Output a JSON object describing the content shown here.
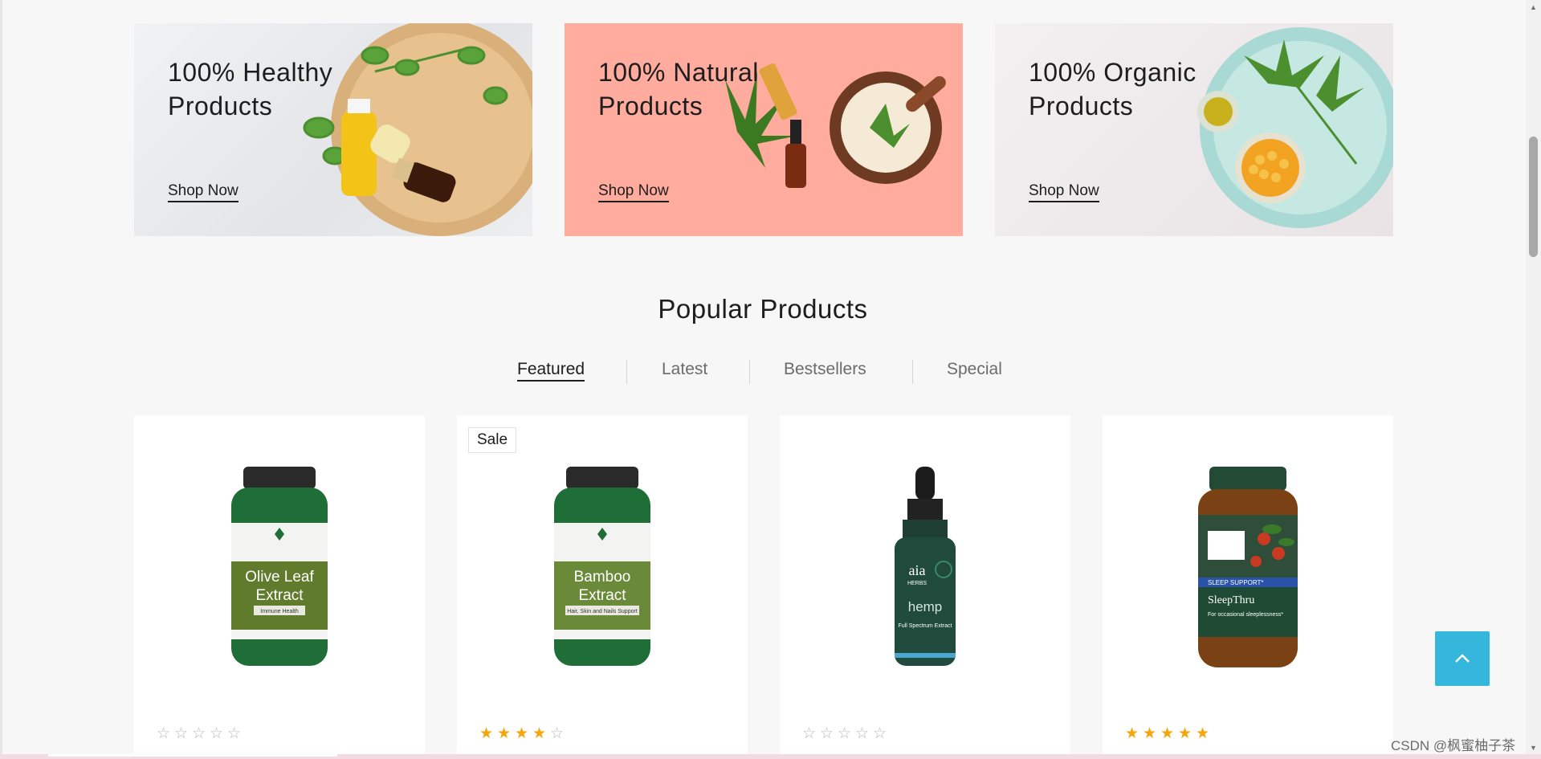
{
  "banners": [
    {
      "title": "100% Healthy\nProducts",
      "link": "Shop Now"
    },
    {
      "title": "100% Natural\nProducts",
      "link": "Shop Now"
    },
    {
      "title": "100% Organic\nProducts",
      "link": "Shop Now"
    }
  ],
  "popular": {
    "title": "Popular Products",
    "tabs": [
      "Featured",
      "Latest",
      "Bestsellers",
      "Special"
    ],
    "active_tab": "Featured"
  },
  "products": [
    {
      "badge": "",
      "label_line1": "Olive Leaf",
      "label_line2": "Extract",
      "sub": "Immune Health",
      "rating": 0
    },
    {
      "badge": "Sale",
      "label_line1": "Bamboo",
      "label_line2": "Extract",
      "sub": "Hair, Skin and Nails Support",
      "rating": 4
    },
    {
      "badge": "",
      "brand": "aia",
      "brand_sub": "HERBS",
      "label_line1": "hemp",
      "sub": "Full Spectrum Extract",
      "rating": 0
    },
    {
      "badge": "",
      "label_line1": "SleepThru",
      "tag": "SLEEP SUPPORT*",
      "sub": "For occasional sleeplessness*",
      "rating": 5
    }
  ],
  "watermark": "CSDN @枫蜜柚子茶",
  "colors": {
    "accent": "#35b7dd",
    "star": "#f4a60d",
    "salmon": "#ffac9e"
  }
}
